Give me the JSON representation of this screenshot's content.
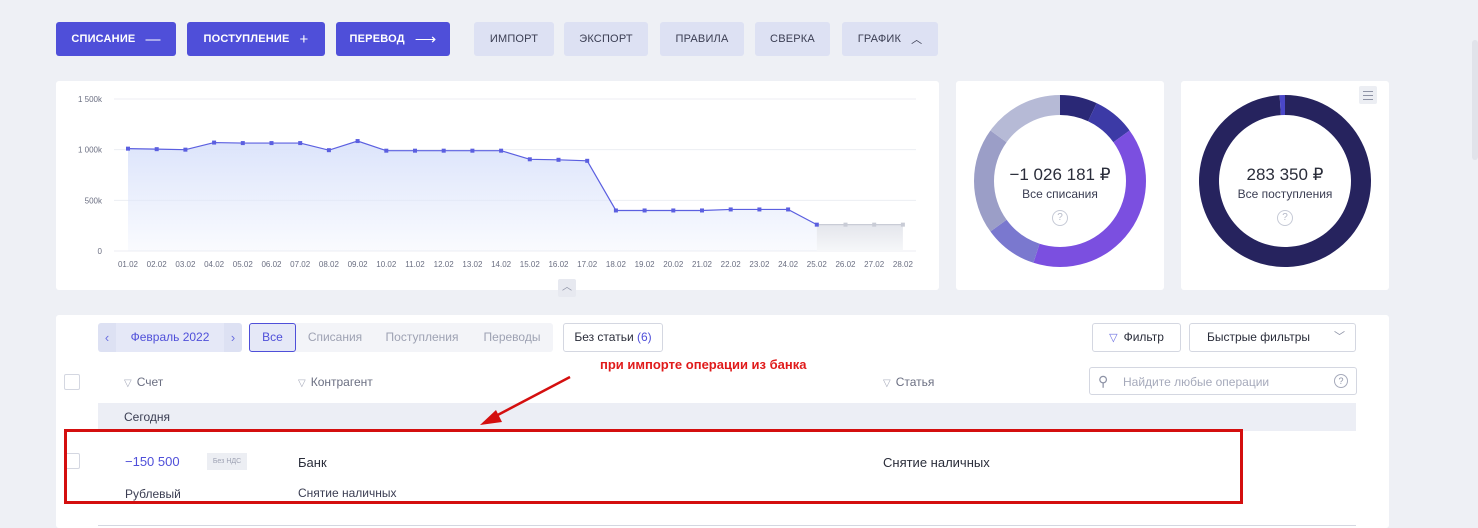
{
  "toolbar": {
    "writeoff": "СПИСАНИЕ",
    "income": "ПОСТУПЛЕНИЕ",
    "transfer": "ПЕРЕВОД",
    "import": "ИМПОРТ",
    "export": "ЭКСПОРТ",
    "rules": "ПРАВИЛА",
    "reconcile": "СВЕРКА",
    "chart": "ГРАФИК"
  },
  "chart_data": {
    "type": "area",
    "title": "",
    "xlabel": "",
    "ylabel": "",
    "ylim": [
      0,
      1500000
    ],
    "y_ticks": [
      "1 500k",
      "1 000k",
      "500k",
      "0"
    ],
    "categories": [
      "01.02",
      "02.02",
      "03.02",
      "04.02",
      "05.02",
      "06.02",
      "07.02",
      "08.02",
      "09.02",
      "10.02",
      "11.02",
      "12.02",
      "13.02",
      "14.02",
      "15.02",
      "16.02",
      "17.02",
      "18.02",
      "19.02",
      "20.02",
      "21.02",
      "22.02",
      "23.02",
      "24.02",
      "25.02",
      "26.02",
      "27.02",
      "28.02"
    ],
    "series": [
      {
        "values": [
          1010000,
          1005000,
          1000000,
          1070000,
          1065000,
          1065000,
          1065000,
          995000,
          1085000,
          990000,
          990000,
          990000,
          990000,
          990000,
          905000,
          900000,
          890000,
          400000,
          400000,
          400000,
          400000,
          410000,
          410000,
          410000,
          260000,
          260000,
          260000,
          260000
        ]
      }
    ],
    "forecast_from_index": 24,
    "grid": true,
    "colors": {
      "line": "#5b5fe0",
      "fill": "#dce4fb",
      "forecast": "#c9ccd6"
    }
  },
  "donut_writeoffs": {
    "value": "−1 026 181 ₽",
    "label": "Все списания",
    "slices": [
      {
        "value": 7,
        "color": "#2a2876"
      },
      {
        "value": 8,
        "color": "#3c3aa6"
      },
      {
        "value": 40,
        "color": "#7b4fe0"
      },
      {
        "value": 10,
        "color": "#7a78cf"
      },
      {
        "value": 20,
        "color": "#9b9ec7"
      },
      {
        "value": 15,
        "color": "#b6bad6"
      }
    ]
  },
  "donut_income": {
    "value": "283 350 ₽",
    "label": "Все поступления",
    "slices": [
      {
        "value": 99,
        "color": "#26235e"
      },
      {
        "value": 1,
        "color": "#4a47c8"
      }
    ]
  },
  "help_glyph": "?",
  "table": {
    "month": "Февраль 2022",
    "tabs": [
      "Все",
      "Списания",
      "Поступления",
      "Переводы"
    ],
    "no_article_label": "Без статьи",
    "no_article_count": "(6)",
    "filter_label": "Фильтр",
    "quick_filters_label": "Быстрые фильтры",
    "search_placeholder": "Найдите любые операции",
    "columns": {
      "account": "Счет",
      "counterparty": "Контрагент",
      "article": "Статья"
    },
    "group_label": "Сегодня",
    "rows": [
      {
        "amount": "−150 500",
        "vat": "Без НДС",
        "counterparty": "Банк",
        "article": "Снятие наличных",
        "account_name": "Рублевый",
        "description": "Снятие наличных"
      }
    ]
  },
  "annotation": {
    "text": "при импорте операции из банка",
    "color": "#e01b1b"
  }
}
